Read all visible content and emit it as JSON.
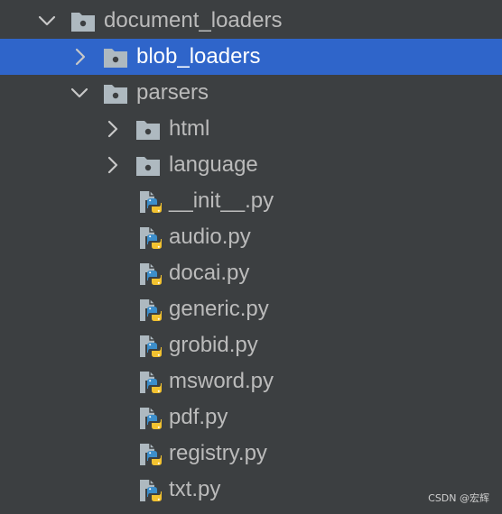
{
  "tree": {
    "root": {
      "label": "document_loaders"
    },
    "blob_loaders": {
      "label": "blob_loaders"
    },
    "parsers": {
      "label": "parsers"
    },
    "html": {
      "label": "html"
    },
    "language": {
      "label": "language"
    },
    "files": [
      {
        "label": "__init__.py"
      },
      {
        "label": "audio.py"
      },
      {
        "label": "docai.py"
      },
      {
        "label": "generic.py"
      },
      {
        "label": "grobid.py"
      },
      {
        "label": "msword.py"
      },
      {
        "label": "pdf.py"
      },
      {
        "label": "registry.py"
      },
      {
        "label": "txt.py"
      }
    ]
  },
  "watermark": "CSDN @宏辉",
  "colors": {
    "background": "#3c3f41",
    "selection": "#2f65ca",
    "text": "#bbbbbb",
    "selected_text": "#ffffff",
    "folder_icon": "#aeb9c0",
    "python_blue": "#3c8ecb",
    "python_yellow": "#f2c230"
  },
  "icons": {
    "expanded": "chevron-down-icon",
    "collapsed": "chevron-right-icon",
    "folder": "folder-icon",
    "python_file": "python-file-icon"
  }
}
